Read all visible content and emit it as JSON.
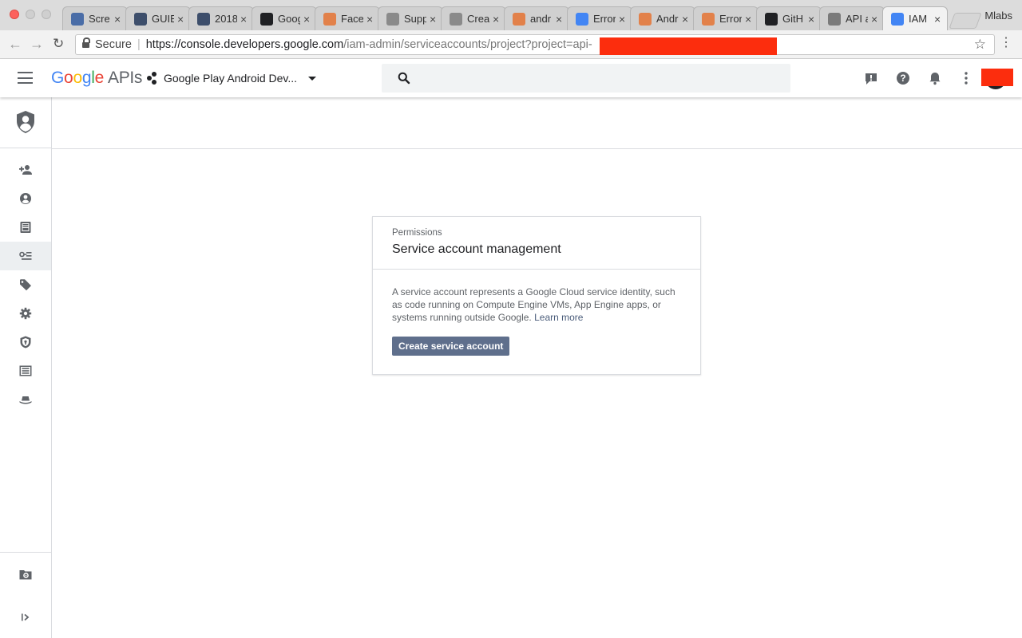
{
  "browser": {
    "tabs": [
      {
        "label": "Scre",
        "favicon": "cloud-icon",
        "color": "#4a6da7"
      },
      {
        "label": "GUIE",
        "favicon": "notion-icon",
        "color": "#3d4e6b"
      },
      {
        "label": "2018",
        "favicon": "notion-icon",
        "color": "#3d4e6b"
      },
      {
        "label": "Goog",
        "favicon": "ai-icon",
        "color": "#202124"
      },
      {
        "label": "Face",
        "favicon": "stackoverflow-icon",
        "color": "#e2814a"
      },
      {
        "label": "Supp",
        "favicon": "android-icon",
        "color": "#8a8a8a"
      },
      {
        "label": "Crea",
        "favicon": "android-icon",
        "color": "#8a8a8a"
      },
      {
        "label": "andr",
        "favicon": "stackoverflow-icon",
        "color": "#e2814a"
      },
      {
        "label": "Error",
        "favicon": "google-icon",
        "color": "#4285f4"
      },
      {
        "label": "Andr",
        "favicon": "stackoverflow-icon",
        "color": "#e2814a"
      },
      {
        "label": "Error",
        "favicon": "stackoverflow-icon",
        "color": "#e2814a"
      },
      {
        "label": "GitH",
        "favicon": "github-icon",
        "color": "#202124"
      },
      {
        "label": "API a",
        "favicon": "play-icon",
        "color": "#7a7a7a"
      },
      {
        "label": "IAM",
        "favicon": "google-icon",
        "color": "#4285f4"
      }
    ],
    "profile_name": "Mlabs",
    "secure_label": "Secure",
    "url_host": "https://console.developers.google.com",
    "url_path": "/iam-admin/serviceaccounts/project?project=api-"
  },
  "header": {
    "logo_google": [
      "G",
      "o",
      "o",
      "g",
      "l",
      "e"
    ],
    "logo_apis": "APIs",
    "project_name": "Google Play Android Dev...",
    "search_placeholder": ""
  },
  "card": {
    "eyebrow": "Permissions",
    "title": "Service account management",
    "description": "A service account represents a Google Cloud service identity, such as code running on Compute Engine VMs, App Engine apps, or systems running outside Google.",
    "learn_more": "Learn more",
    "button_label": "Create service account"
  },
  "colors": {
    "brand_blue": "#4285f4",
    "brand_red": "#ea4335",
    "brand_yellow": "#fbbc05",
    "brand_green": "#34a853",
    "button": "#5f6f8c",
    "redaction": "#fc2d0d"
  }
}
